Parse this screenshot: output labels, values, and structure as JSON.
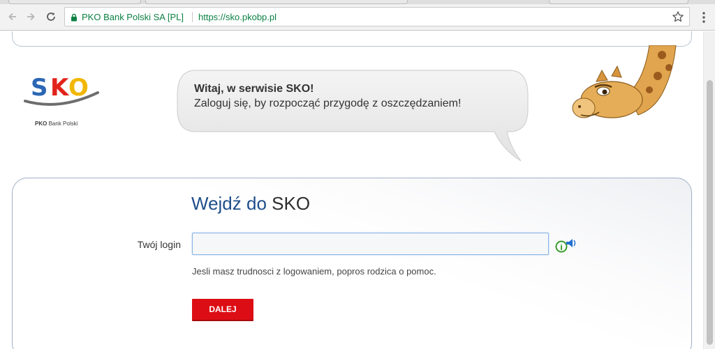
{
  "browser": {
    "site_identity": "PKO Bank Polski SA [PL]",
    "url": "https://sko.pkobp.pl"
  },
  "header": {
    "logo_text": "SKO",
    "brand_bold": "PKO",
    "brand_rest": "Bank Polski",
    "greeting_title": "Witaj, w serwisie SKO!",
    "greeting_subtitle": "Zaloguj się, by rozpocząć przygodę z oszczędzaniem!"
  },
  "login": {
    "heading_prefix": "Wejdź do",
    "heading_bold": "SKO",
    "login_label": "Twój login",
    "login_value": "",
    "hint": "Jesli masz trudnosci z logowaniem, popros rodzica o pomoc.",
    "submit_label": "DALEJ"
  },
  "colors": {
    "accent_red": "#dd0d15",
    "heading_blue": "#1f4f8b",
    "secure_green": "#0b8043"
  },
  "icons": {
    "back": "arrow-left-icon",
    "forward": "arrow-right-icon",
    "reload": "reload-icon",
    "lock": "lock-icon",
    "bookmark": "star-icon",
    "menu": "kebab-menu-icon",
    "login_help": "info-speaker-icon"
  }
}
